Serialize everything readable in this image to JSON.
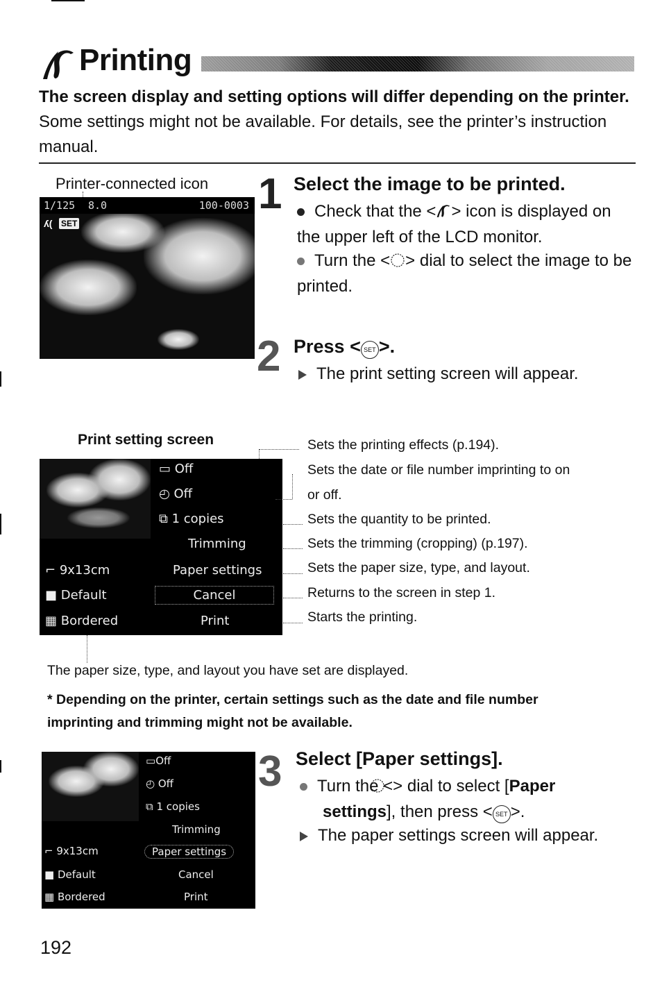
{
  "header": {
    "title": "Printing",
    "title_icon": "printer-connected-icon",
    "intro_bold": "The screen display and setting options will differ depending on the printer.",
    "intro_rest": " Some settings might not be available. For details, see the printer’s instruction manual."
  },
  "step1": {
    "number": "1",
    "heading": "Select the image to be printed.",
    "caption": "Printer-connected icon",
    "bullets": [
      {
        "prefix": "Check that the <",
        "icon": "printer-connected-icon",
        "suffix": "> icon is displayed on the upper left of the LCD monitor."
      },
      {
        "prefix": "Turn the <",
        "icon": "quick-control-dial-icon",
        "suffix": "> dial to select the image to be printed."
      }
    ],
    "lcd": {
      "shutter": "1/125",
      "aperture": "8.0",
      "file_number": "100-0003",
      "set_badge": "SET"
    }
  },
  "step2": {
    "number": "2",
    "heading_prefix": "Press <",
    "heading_icon": "set-button-icon",
    "heading_suffix": ">.",
    "result": "The print setting screen will appear.",
    "set_label": "SET"
  },
  "print_setting_screen": {
    "label": "Print setting screen",
    "right_items": [
      {
        "icon": "effects-icon",
        "label": "Off"
      },
      {
        "icon": "date-imprint-icon",
        "label": "Off"
      },
      {
        "icon": "copies-icon",
        "label": "1   copies"
      },
      {
        "icon": "",
        "label": "Trimming"
      },
      {
        "icon": "",
        "label": "Paper settings"
      },
      {
        "icon": "",
        "label": "Cancel"
      },
      {
        "icon": "",
        "label": "Print"
      }
    ],
    "left_items": [
      {
        "icon": "paper-size-icon",
        "label": "9x13cm"
      },
      {
        "icon": "paper-type-icon",
        "label": "Default"
      },
      {
        "icon": "layout-icon",
        "label": "Bordered"
      }
    ],
    "selected": "Cancel",
    "callouts": [
      "Sets the printing effects (p.194).",
      "Sets the date or file number imprinting to on",
      "or off.",
      "Sets the quantity to be printed.",
      "Sets the trimming (cropping) (p.197).",
      "Sets the paper size, type, and layout.",
      "Returns to the screen in step 1.",
      "Starts the printing."
    ],
    "bottom_note": "The paper size, type, and layout you have set are displayed.",
    "warning": "* Depending on the printer, certain settings such as the date and file number imprinting and trimming might not be available."
  },
  "step3": {
    "number": "3",
    "heading": "Select [Paper settings].",
    "bullet_prefix": "Turn the <",
    "bullet_mid": "> dial to select [",
    "bullet_bold": "Paper settings",
    "bullet_suffix_a": "], then press <",
    "bullet_suffix_b": ">.",
    "result": "The paper settings screen will appear.",
    "set_label": "SET",
    "lcd": {
      "right_items": [
        "Off",
        "Off",
        "1   copies",
        "Trimming",
        "Paper settings",
        "Cancel",
        "Print"
      ],
      "left_items": [
        "9x13cm",
        "Default",
        "Bordered"
      ],
      "selected": "Paper settings"
    }
  },
  "footer": {
    "page_number": "192"
  }
}
